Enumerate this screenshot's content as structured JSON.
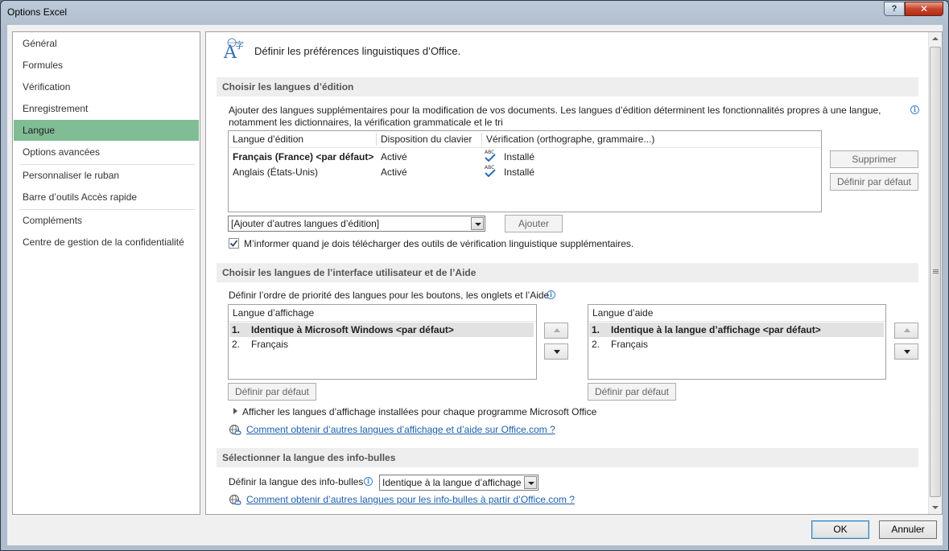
{
  "window": {
    "title": "Options Excel",
    "help_label": "?",
    "close_label": "✕"
  },
  "nav": {
    "items": [
      {
        "label": "Général"
      },
      {
        "label": "Formules"
      },
      {
        "label": "Vérification"
      },
      {
        "label": "Enregistrement"
      },
      {
        "label": "Langue"
      },
      {
        "label": "Options avancées"
      },
      {
        "label": "Personnaliser le ruban"
      },
      {
        "label": "Barre d’outils Accès rapide"
      },
      {
        "label": "Compléments"
      },
      {
        "label": "Centre de gestion de la confidentialité"
      }
    ],
    "active": "Langue"
  },
  "header": {
    "title": "Définir les préférences linguistiques d’Office."
  },
  "editing": {
    "section_title": "Choisir les langues d’édition",
    "description": "Ajouter des langues supplémentaires pour la modification de vos documents. Les langues d’édition déterminent les fonctionnalités propres à une langue,",
    "description2": "notamment les dictionnaires, la vérification grammaticale et le tri",
    "columns": [
      "Langue d’édition",
      "Disposition du clavier",
      "Vérification (orthographe, grammaire...)"
    ],
    "rows": [
      {
        "language": "Français (France) <par défaut>",
        "keyboard": "Activé",
        "proofing": "Installé"
      },
      {
        "language": "Anglais (États-Unis)",
        "keyboard": "Activé",
        "proofing": "Installé"
      }
    ],
    "remove_button": "Supprimer",
    "set_default_button": "Définir par défaut",
    "add_combo_value": "[Ajouter d’autres langues d’édition]",
    "add_button": "Ajouter",
    "notify_checkbox_label": "M’informer quand je dois télécharger des outils de vérification linguistique supplémentaires.",
    "notify_checked": true
  },
  "ui": {
    "section_title": "Choisir les langues de l’interface utilisateur et de l’Aide",
    "description": "Définir l’ordre de priorité des langues pour les boutons, les onglets et l’Aide",
    "display": {
      "header": "Langue d’affichage",
      "items": [
        {
          "num": "1.",
          "label": "Identique à Microsoft Windows <par défaut>"
        },
        {
          "num": "2.",
          "label": "Français"
        }
      ],
      "set_default_button": "Définir par défaut"
    },
    "help": {
      "header": "Langue d’aide",
      "items": [
        {
          "num": "1.",
          "label": "Identique à la langue d’affichage <par défaut>"
        },
        {
          "num": "2.",
          "label": "Français"
        }
      ],
      "set_default_button": "Définir par défaut"
    },
    "expand_label": "Afficher les langues d’affichage installées pour chaque programme Microsoft Office",
    "link": "Comment obtenir d’autres langues d’affichage et d’aide sur Office.com ?"
  },
  "tooltip": {
    "section_title": "Sélectionner la langue des info-bulles",
    "label": "Définir la langue des info-bulles",
    "combo_value": "Identique à la langue d’affichage",
    "link": "Comment obtenir d’autres langues pour les info-bulles à partir d’Office.com ?"
  },
  "footer": {
    "ok": "OK",
    "cancel": "Annuler"
  }
}
